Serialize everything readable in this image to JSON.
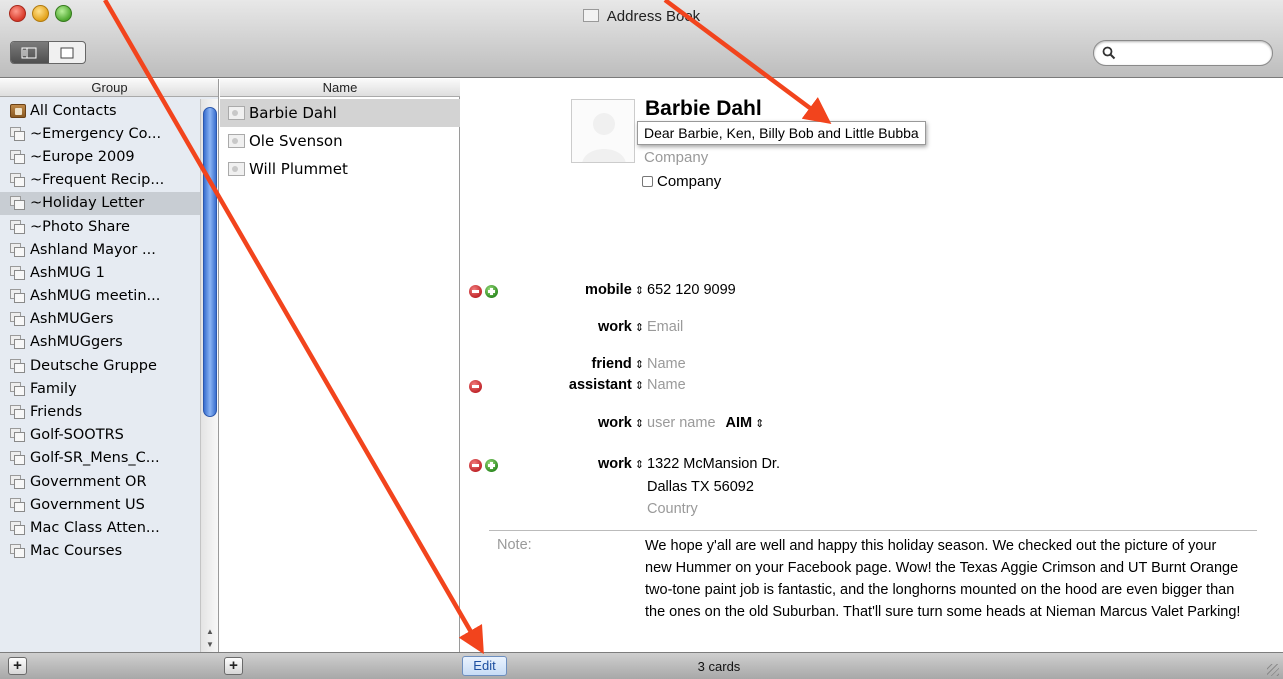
{
  "window": {
    "title": "Address Book"
  },
  "toolbar": {
    "search": {
      "placeholder": "",
      "value": ""
    }
  },
  "columns": {
    "group_header": "Group",
    "name_header": "Name"
  },
  "groups": [
    {
      "label": "All Contacts",
      "icon": "address-book-icon"
    },
    {
      "label": "~Emergency Co...",
      "icon": "group-icon"
    },
    {
      "label": "~Europe 2009",
      "icon": "group-icon"
    },
    {
      "label": "~Frequent Recip...",
      "icon": "group-icon"
    },
    {
      "label": "~Holiday Letter",
      "icon": "group-icon",
      "selected": true
    },
    {
      "label": "~Photo Share",
      "icon": "group-icon"
    },
    {
      "label": "Ashland Mayor ...",
      "icon": "group-icon"
    },
    {
      "label": "AshMUG 1",
      "icon": "group-icon"
    },
    {
      "label": "AshMUG meetin...",
      "icon": "group-icon"
    },
    {
      "label": "AshMUGers",
      "icon": "group-icon"
    },
    {
      "label": "AshMUGgers",
      "icon": "group-icon"
    },
    {
      "label": "Deutsche Gruppe",
      "icon": "group-icon"
    },
    {
      "label": "Family",
      "icon": "group-icon"
    },
    {
      "label": "Friends",
      "icon": "group-icon"
    },
    {
      "label": "Golf-SOOTRS",
      "icon": "group-icon"
    },
    {
      "label": "Golf-SR_Mens_C...",
      "icon": "group-icon"
    },
    {
      "label": "Government OR",
      "icon": "group-icon"
    },
    {
      "label": "Government US",
      "icon": "group-icon"
    },
    {
      "label": "Mac Class Atten...",
      "icon": "group-icon"
    },
    {
      "label": "Mac Courses",
      "icon": "group-icon"
    }
  ],
  "names": [
    {
      "label": "Barbie Dahl",
      "selected": true
    },
    {
      "label": "Ole Svenson"
    },
    {
      "label": "Will Plummet"
    }
  ],
  "card": {
    "name": "Barbie Dahl",
    "tooltip": "Dear Barbie, Ken, Billy Bob and Little Bubba",
    "company_placeholder": "Company",
    "company_checkbox_label": "Company",
    "phone": {
      "label": "mobile",
      "value": "652 120 9099"
    },
    "email": {
      "label": "work",
      "placeholder": "Email"
    },
    "related1": {
      "label": "friend",
      "placeholder": "Name"
    },
    "related2": {
      "label": "assistant",
      "placeholder": "Name"
    },
    "im": {
      "label": "work",
      "placeholder": "user name",
      "service": "AIM"
    },
    "address": {
      "label": "work",
      "street": "1322 McMansion Dr.",
      "city_line": "Dallas TX 56092",
      "country_placeholder": "Country"
    },
    "note_label": "Note:",
    "note": "We hope y'all are well and happy this holiday season. We checked out the picture of your new Hummer on your Facebook page. Wow! the Texas Aggie Crimson and UT Burnt Orange two-tone paint job is fantastic, and the longhorns mounted on the hood are even bigger than the ones on the old Suburban. That'll sure turn some heads at Nieman Marcus Valet Parking!"
  },
  "bottom": {
    "edit_label": "Edit",
    "card_count": "3 cards",
    "add_group": "+",
    "add_name": "+"
  },
  "colors": {
    "annotation_arrow": "#f2441d",
    "selection": "#c8cdd3",
    "scroll_thumb": "#3a6fcf"
  }
}
